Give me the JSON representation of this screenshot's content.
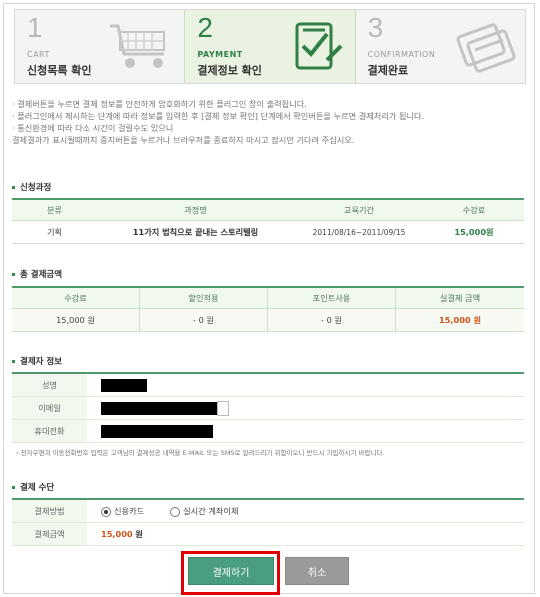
{
  "steps": [
    {
      "num": "1",
      "en": "CART",
      "ko": "신청목록 확인",
      "active": false
    },
    {
      "num": "2",
      "en": "PAYMENT",
      "ko": "결제정보 확인",
      "active": true
    },
    {
      "num": "3",
      "en": "CONFIRMATION",
      "ko": "결제완료",
      "active": false
    }
  ],
  "notes": [
    "· 결제버튼을 누르면 결제 정보를 안전하게 암호화하기 위한 플러그인 창이 출력됩니다.",
    "· 플러그인에서 제시하는 단계에 따라 정보를 입력한 후 [결제 정보 확인] 단계에서 확인버튼을 누르면 결제처리가 됩니다.",
    "· 통신환경에 따라 다소 시간이 걸릴수도 있으니",
    "   결제결과가 표시될때까지 중지버튼을 누르거나 브라우저를 종료하지 마시고 잠시만 기다려 주십시오."
  ],
  "course": {
    "title": "신청과정",
    "headers": [
      "분류",
      "과정명",
      "교육기간",
      "수강료"
    ],
    "row": {
      "category": "기획",
      "name": "11가지 법칙으로 끝내는 스토리텔링",
      "period": "2011/08/16~2011/09/15",
      "fee": "15,000원"
    }
  },
  "total": {
    "title": "총 결제금액",
    "headers": [
      "수강료",
      "할인적용",
      "포인트사용",
      "실결제 금액"
    ],
    "values": [
      "15,000 원",
      "- 0 원",
      "- 0 원",
      "15,000 원"
    ]
  },
  "payer": {
    "title": "결제자 정보",
    "labels": [
      "성명",
      "이메일",
      "휴대전화"
    ],
    "notice": "› 전자우편과 이동전화번호 입력은 고객님의 결제성공 내역을 E-MAIL 또는 SMS로 알려드리기 위함이오니 반드시 기입하시기 바랍니다."
  },
  "method": {
    "title": "결제 수단",
    "label_method": "결제방법",
    "opt_card": "신용카드",
    "opt_transfer": "실시간 계좌이체",
    "label_amount": "결제금액",
    "amount_value": "15,000",
    "amount_unit": "원"
  },
  "buttons": {
    "pay": "결제하기",
    "cancel": "취소"
  },
  "colors": {
    "accent": "#4f9a6b",
    "highlight_border": "#e00000",
    "pay_button": "#4a9e80",
    "cancel_button": "#9a9a9a"
  }
}
